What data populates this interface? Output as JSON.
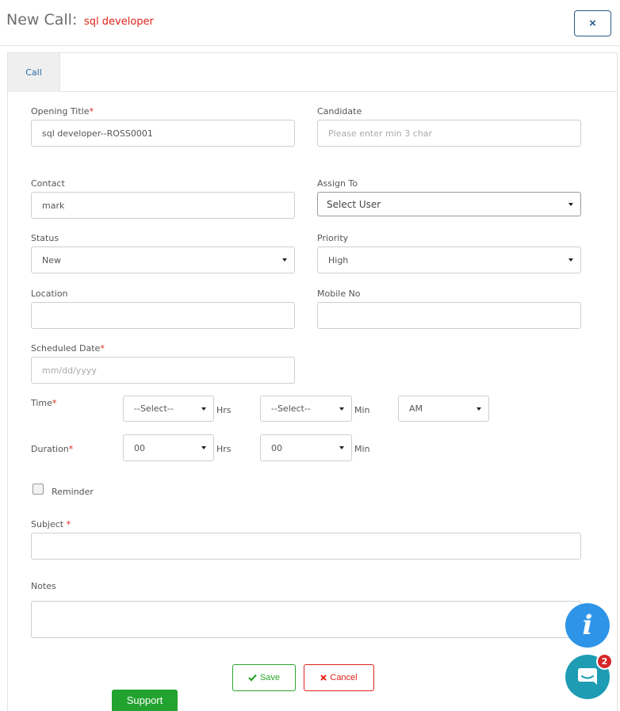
{
  "header": {
    "title": "New Call:",
    "subtitle": "sql developer",
    "close_label": "×"
  },
  "tabs": [
    {
      "label": "Call"
    }
  ],
  "form": {
    "opening_title": {
      "label": "Opening Title",
      "required": "*",
      "value": "sql developer--ROSS0001"
    },
    "candidate": {
      "label": "Candidate",
      "placeholder": "Please enter min 3 char"
    },
    "contact": {
      "label": "Contact",
      "value": "mark"
    },
    "assign_to": {
      "label": "Assign To",
      "value": "Select User"
    },
    "status": {
      "label": "Status",
      "value": "New"
    },
    "priority": {
      "label": "Priority",
      "value": "High"
    },
    "location": {
      "label": "Location",
      "value": ""
    },
    "mobile_no": {
      "label": "Mobile No",
      "value": ""
    },
    "scheduled_date": {
      "label": "Scheduled Date",
      "required": "*",
      "placeholder": "mm/dd/yyyy"
    },
    "time": {
      "label": "Time",
      "required": "*",
      "hours": "--Select--",
      "minutes": "--Select--",
      "ampm": "AM"
    },
    "duration": {
      "label": "Duration",
      "required": "*",
      "hours": "00",
      "minutes": "00"
    },
    "units": {
      "hrs": "Hrs",
      "min": "Min"
    },
    "reminder": {
      "label": "Reminder",
      "checked": false
    },
    "subject": {
      "label": "Subject ",
      "required": "*",
      "value": ""
    },
    "notes": {
      "label": "Notes",
      "value": ""
    }
  },
  "actions": {
    "save_label": "Save",
    "cancel_label": "Cancel",
    "support_label": "Support"
  },
  "widgets": {
    "info_icon": "i",
    "chat_badge_count": "2",
    "colors": {
      "info": "#2e94e8",
      "chat": "#1d9cb3",
      "badge": "#d7262a",
      "save": "#2aa52a",
      "cancel": "#e2231a"
    }
  }
}
